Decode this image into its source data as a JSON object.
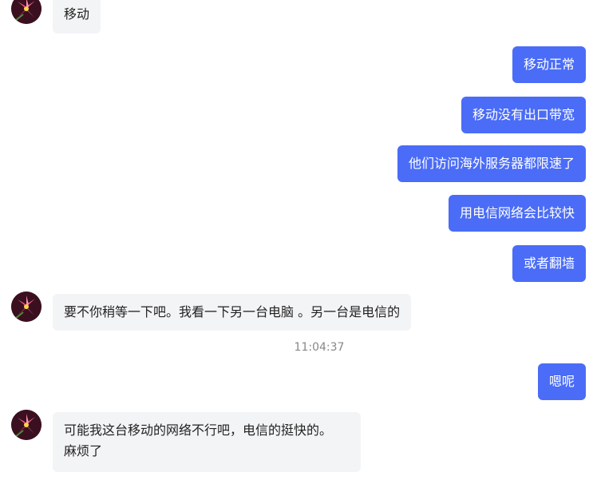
{
  "messages": {
    "m1": "移动",
    "m2": "移动正常",
    "m3": "移动没有出口带宽",
    "m4": "他们访问海外服务器都限速了",
    "m5": "用电信网络会比较快",
    "m6": "或者翻墙",
    "m7": "要不你稍等一下吧。我看一下另一台电脑 。另一台是电信的",
    "m8": "嗯呢",
    "m9_line1": "可能我这台移动的网络不行吧，电信的挺快的。",
    "m9_line2": "麻烦了"
  },
  "timestamp": "11:04:37",
  "colors": {
    "outgoing_bubble": "#4a6cf7",
    "incoming_bubble": "#f3f4f6",
    "timestamp_text": "#888888"
  },
  "icons": {
    "avatar": "lily-flower-avatar"
  }
}
